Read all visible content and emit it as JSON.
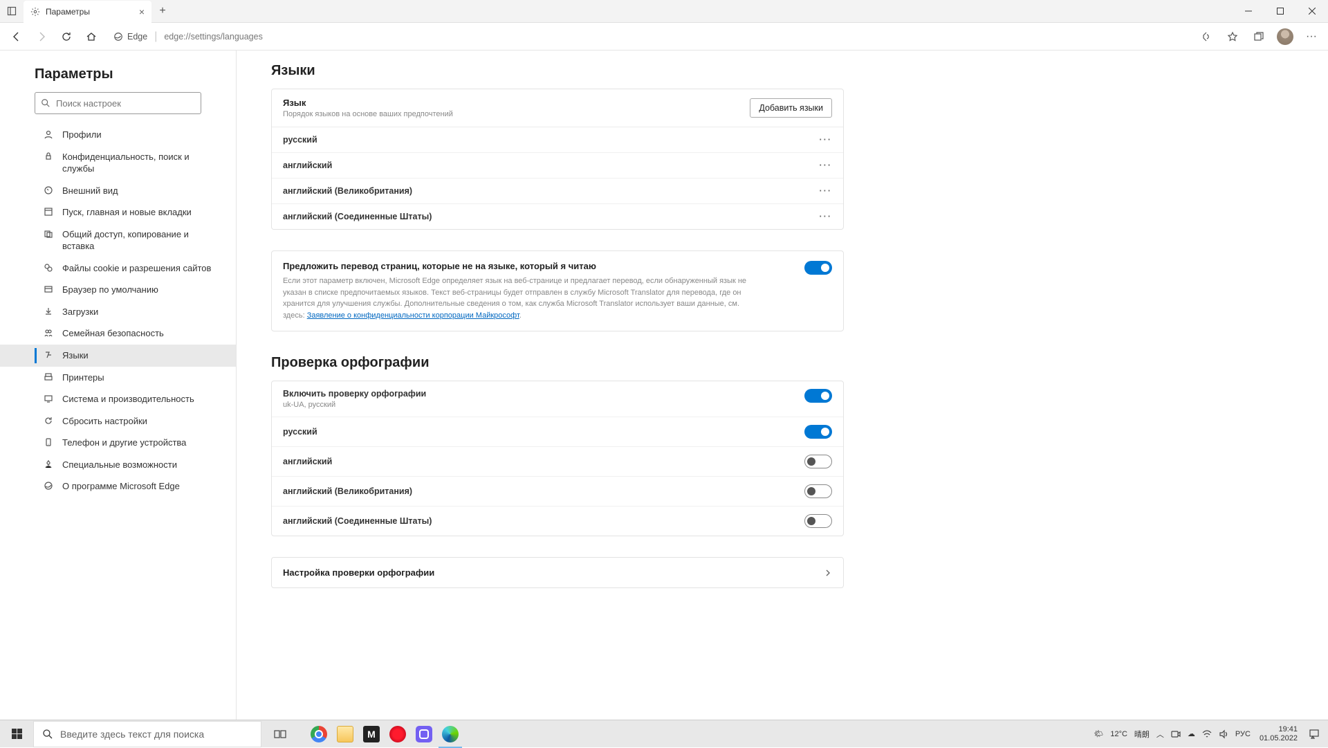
{
  "titlebar": {
    "tab_title": "Параметры"
  },
  "addressbar": {
    "edge_label": "Edge",
    "url": "edge://settings/languages"
  },
  "sidebar": {
    "title": "Параметры",
    "search_placeholder": "Поиск настроек",
    "items": [
      {
        "label": "Профили"
      },
      {
        "label": "Конфиденциальность, поиск и службы"
      },
      {
        "label": "Внешний вид"
      },
      {
        "label": "Пуск, главная и новые вкладки"
      },
      {
        "label": "Общий доступ, копирование и вставка"
      },
      {
        "label": "Файлы cookie и разрешения сайтов"
      },
      {
        "label": "Браузер по умолчанию"
      },
      {
        "label": "Загрузки"
      },
      {
        "label": "Семейная безопасность"
      },
      {
        "label": "Языки"
      },
      {
        "label": "Принтеры"
      },
      {
        "label": "Система и производительность"
      },
      {
        "label": "Сбросить настройки"
      },
      {
        "label": "Телефон и другие устройства"
      },
      {
        "label": "Специальные возможности"
      },
      {
        "label": "О программе Microsoft Edge"
      }
    ]
  },
  "main": {
    "section_languages": "Языки",
    "lang_card": {
      "title": "Язык",
      "subtitle": "Порядок языков на основе ваших предпочтений",
      "add_button": "Добавить языки",
      "rows": [
        "русский",
        "английский",
        "английский (Великобритания)",
        "английский (Соединенные Штаты)"
      ]
    },
    "translate": {
      "title": "Предложить перевод страниц, которые не на языке, который я читаю",
      "desc": "Если этот параметр включен, Microsoft Edge определяет язык на веб-странице и предлагает перевод, если обнаруженный язык не указан в списке предпочитаемых языков. Текст веб-страницы будет отправлен в службу Microsoft Translator для перевода, где он хранится для улучшения службы. Дополнительные сведения о том, как служба Microsoft Translator использует ваши данные, см. здесь: ",
      "link": "Заявление о конфиденциальности корпорации Майкрософт",
      "on": true
    },
    "section_spell": "Проверка орфографии",
    "spell": {
      "enable_title": "Включить проверку орфографии",
      "enable_sub": "uk-UA, русский",
      "rows": [
        {
          "label": "русский",
          "on": true
        },
        {
          "label": "английский",
          "on": false
        },
        {
          "label": "английский (Великобритания)",
          "on": false
        },
        {
          "label": "английский (Соединенные Штаты)",
          "on": false
        }
      ]
    },
    "spell_settings": "Настройка проверки орфографии"
  },
  "taskbar": {
    "search_placeholder": "Введите здесь текст для поиска",
    "weather_temp": "12°C",
    "weather_label": "晴朗",
    "lang": "РУС",
    "time": "19:41",
    "date": "01.05.2022"
  }
}
